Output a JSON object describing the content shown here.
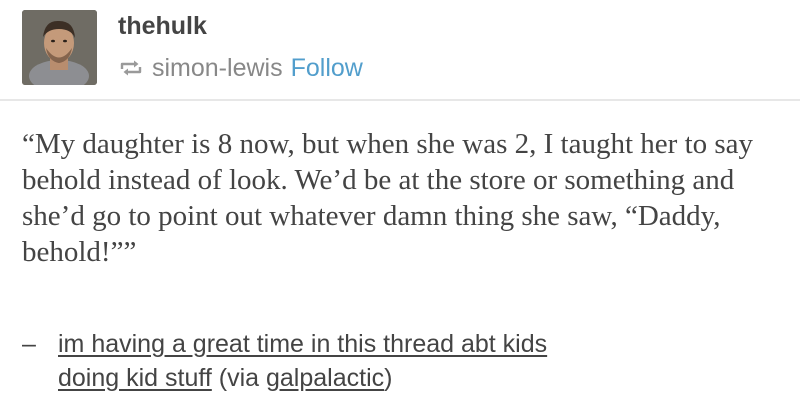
{
  "post": {
    "author": "thehulk",
    "reblogged_from": "simon-lewis",
    "follow_label": "Follow",
    "reblog_icon": "reblog-icon"
  },
  "quote": {
    "text": "“My daughter is 8 now, but when she was 2, I taught her to say behold instead of look. We’d be at the store or something and she’d go to point out whatever damn thing she saw, “Daddy, behold!””"
  },
  "source": {
    "dash": "–",
    "link_line1": "im having a great time in this thread abt kids",
    "link_line2": "doing kid stuff",
    "via_prefix": "(via ",
    "via_user": "galpalactic",
    "via_suffix": ")"
  }
}
